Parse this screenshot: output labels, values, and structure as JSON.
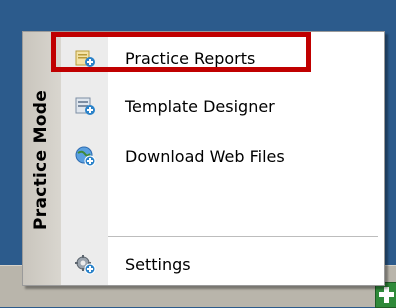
{
  "menu": {
    "sidebar_title": "Practice Mode",
    "items": [
      {
        "label": "Practice Reports",
        "icon": "report-add-icon"
      },
      {
        "label": "Template Designer",
        "icon": "template-icon"
      },
      {
        "label": "Download Web Files",
        "icon": "globe-download-icon"
      },
      {
        "label": "Settings",
        "icon": "gear-icon"
      }
    ],
    "highlight_color": "#c00000"
  }
}
